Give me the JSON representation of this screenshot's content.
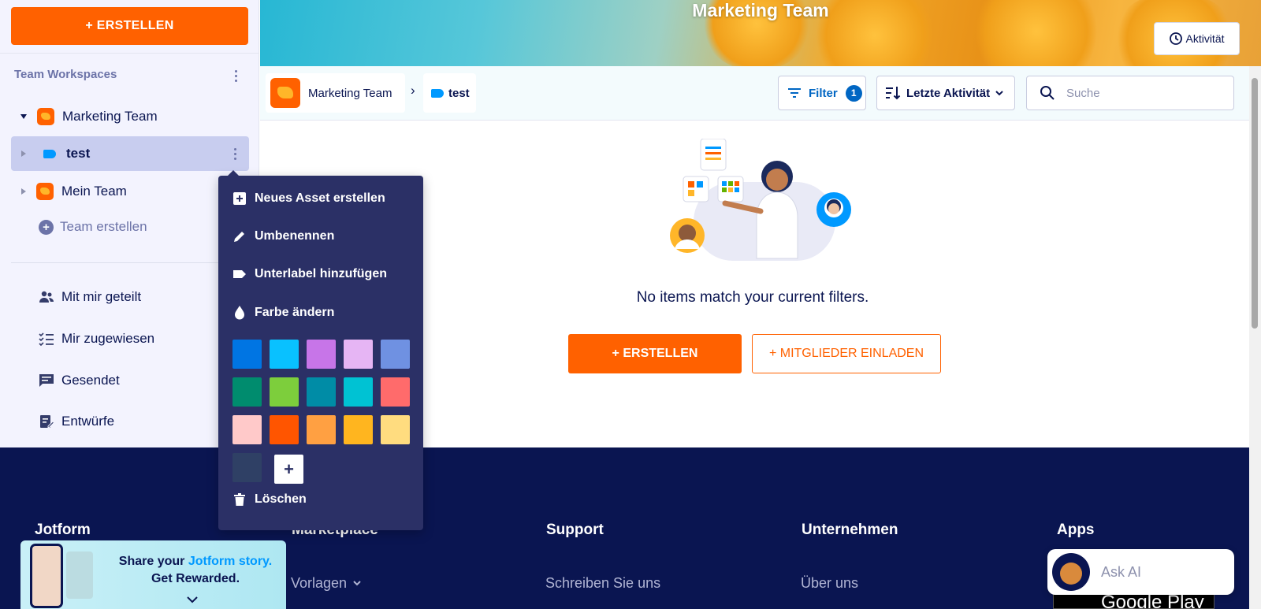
{
  "sidebar": {
    "create_label": "+ ERSTELLEN",
    "workspaces_title": "Team Workspaces",
    "teams": [
      {
        "label": "Marketing Team"
      },
      {
        "label": "test"
      },
      {
        "label": "Mein Team"
      }
    ],
    "create_team_label": "Team erstellen",
    "nav": [
      {
        "label": "Mit mir geteilt",
        "icon": "people-icon"
      },
      {
        "label": "Mir zugewiesen",
        "icon": "checklist-icon"
      },
      {
        "label": "Gesendet",
        "icon": "message-icon"
      },
      {
        "label": "Entwürfe",
        "icon": "draft-icon"
      }
    ]
  },
  "header": {
    "title": "Marketing Team",
    "activity_label": "Aktivität"
  },
  "toolbar": {
    "breadcrumb_team": "Marketing Team",
    "breadcrumb_sep": "›",
    "breadcrumb_label": "test",
    "filter_label": "Filter",
    "filter_count": "1",
    "sort_label": "Letzte Aktivität",
    "search_placeholder": "Suche"
  },
  "main": {
    "empty_text": "No items match your current filters.",
    "create_label": "+ ERSTELLEN",
    "invite_label": "+ MITGLIEDER EINLADEN"
  },
  "context_menu": {
    "items": [
      {
        "label": "Neues Asset erstellen",
        "icon": "add-square-icon"
      },
      {
        "label": "Umbenennen",
        "icon": "pencil-icon"
      },
      {
        "label": "Unterlabel hinzufügen",
        "icon": "label-icon"
      },
      {
        "label": "Farbe ändern",
        "icon": "drop-icon"
      }
    ],
    "colors": [
      "#0075e3",
      "#09c1ff",
      "#c775e8",
      "#e6b5f4",
      "#6f91e2",
      "#008c6e",
      "#7dce3c",
      "#008ca6",
      "#00c2d3",
      "#ff6b6b",
      "#ffc9c9",
      "#ff5500",
      "#ffa042",
      "#ffb51f",
      "#ffdc7f",
      "#2f4065"
    ],
    "add_color_label": "+",
    "delete_label": "Löschen"
  },
  "footer": {
    "columns": [
      {
        "heading": "Jotform",
        "link": ""
      },
      {
        "heading": "Marketplace",
        "link": "Vorlagen"
      },
      {
        "heading": "Support",
        "link": "Schreiben Sie uns"
      },
      {
        "heading": "Unternehmen",
        "link": "Über uns"
      },
      {
        "heading": "Apps",
        "link": ""
      }
    ],
    "google_play": "Google Play"
  },
  "promo": {
    "line1_prefix": "Share your",
    "line1_brand": "Jotform story.",
    "line2": "Get Rewarded."
  },
  "ask_ai": {
    "placeholder": "Ask AI"
  }
}
